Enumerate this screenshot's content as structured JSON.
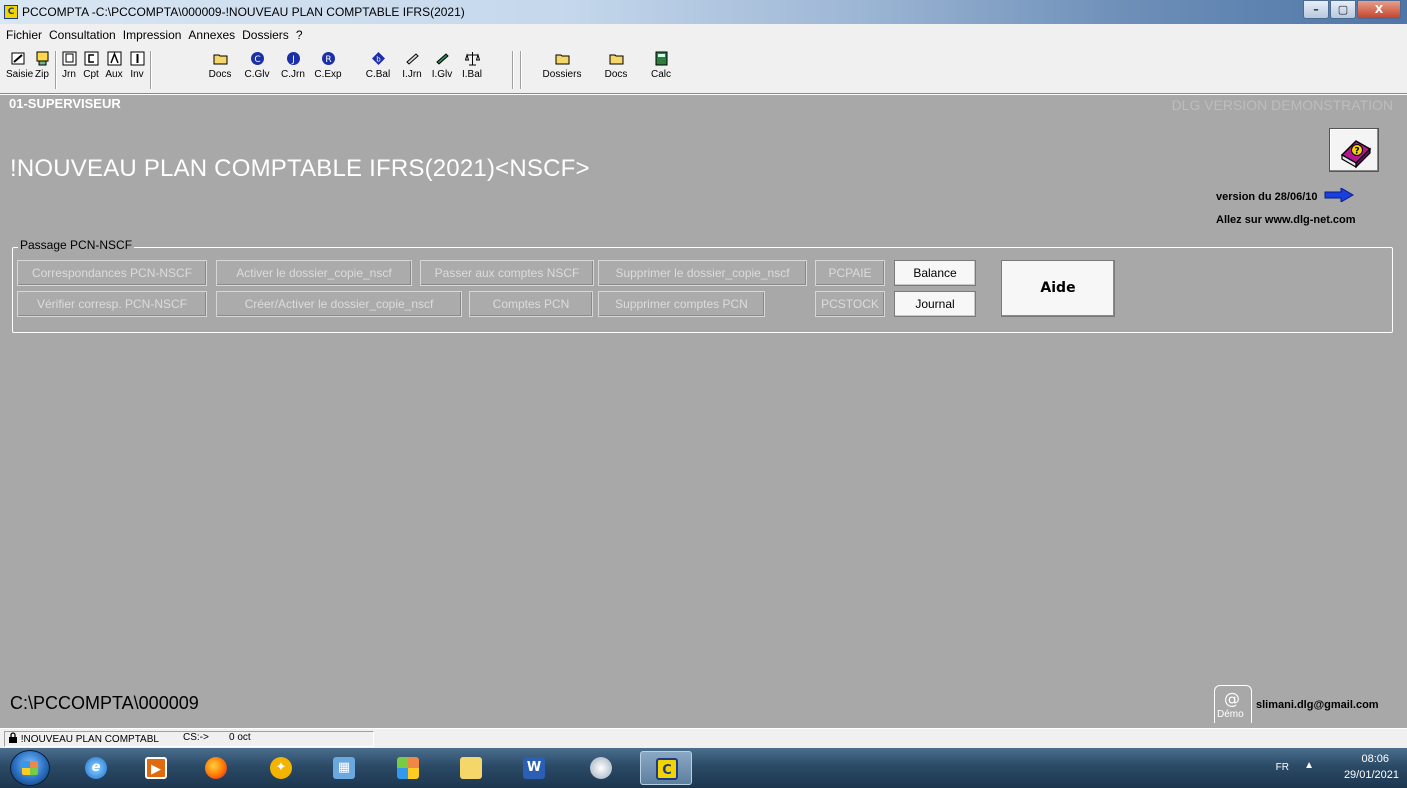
{
  "window": {
    "title": "PCCOMPTA -C:\\PCCOMPTA\\000009-!NOUVEAU PLAN COMPTABLE IFRS(2021)",
    "minimize": "–",
    "maximize": "▢",
    "close": "X"
  },
  "menu": [
    "Fichier",
    "Consultation",
    "Impression",
    "Annexes",
    "Dossiers",
    "?"
  ],
  "toolbar": {
    "saisie": "Saisie",
    "zip": "Zip",
    "jrn": "Jrn",
    "cpt": "Cpt",
    "aux": "Aux",
    "inv": "Inv",
    "docs": "Docs",
    "cglv": "C.Glv",
    "cjrn": "C.Jrn",
    "cexp": "C.Exp",
    "cbal": "C.Bal",
    "ijrn": "I.Jrn",
    "iglv": "I.Glv",
    "ibal": "I.Bal",
    "dossiers": "Dossiers",
    "docs2": "Docs",
    "calc": "Calc"
  },
  "main": {
    "user": "01-SUPERVISEUR",
    "demo_label": "DLG VERSION DEMONSTRATION",
    "title": "!NOUVEAU PLAN COMPTABLE IFRS(2021)<NSCF>",
    "version": "version du 28/06/10",
    "allez": "Allez sur  www.dlg-net.com",
    "group_label": "Passage PCN-NSCF",
    "buttons": {
      "correspondances": "Correspondances PCN-NSCF",
      "activer": "Activer le dossier_copie_nscf",
      "passer": "Passer aux comptes NSCF",
      "supprimer_dossier": "Supprimer le dossier_copie_nscf",
      "pcpaie": "PCPAIE",
      "balance": "Balance",
      "aide": "Aide",
      "verifier": "Vérifier corresp. PCN-NSCF",
      "creer": "Créer/Activer le dossier_copie_nscf",
      "comptes_pcn": "Comptes PCN",
      "supprimer_comptes": "Supprimer comptes PCN",
      "pcstock": "PCSTOCK",
      "journal": "Journal"
    },
    "path": "C:\\PCCOMPTA\\000009",
    "mail_at": "@",
    "mail_tab": "Démo",
    "email": "slimani.dlg@gmail.com"
  },
  "statusbar": {
    "dossier": "!NOUVEAU PLAN COMPTABL",
    "cs": "CS:->",
    "size": "0 oct"
  },
  "taskbar": {
    "lang": "FR",
    "time": "08:06",
    "date": "29/01/2021"
  }
}
